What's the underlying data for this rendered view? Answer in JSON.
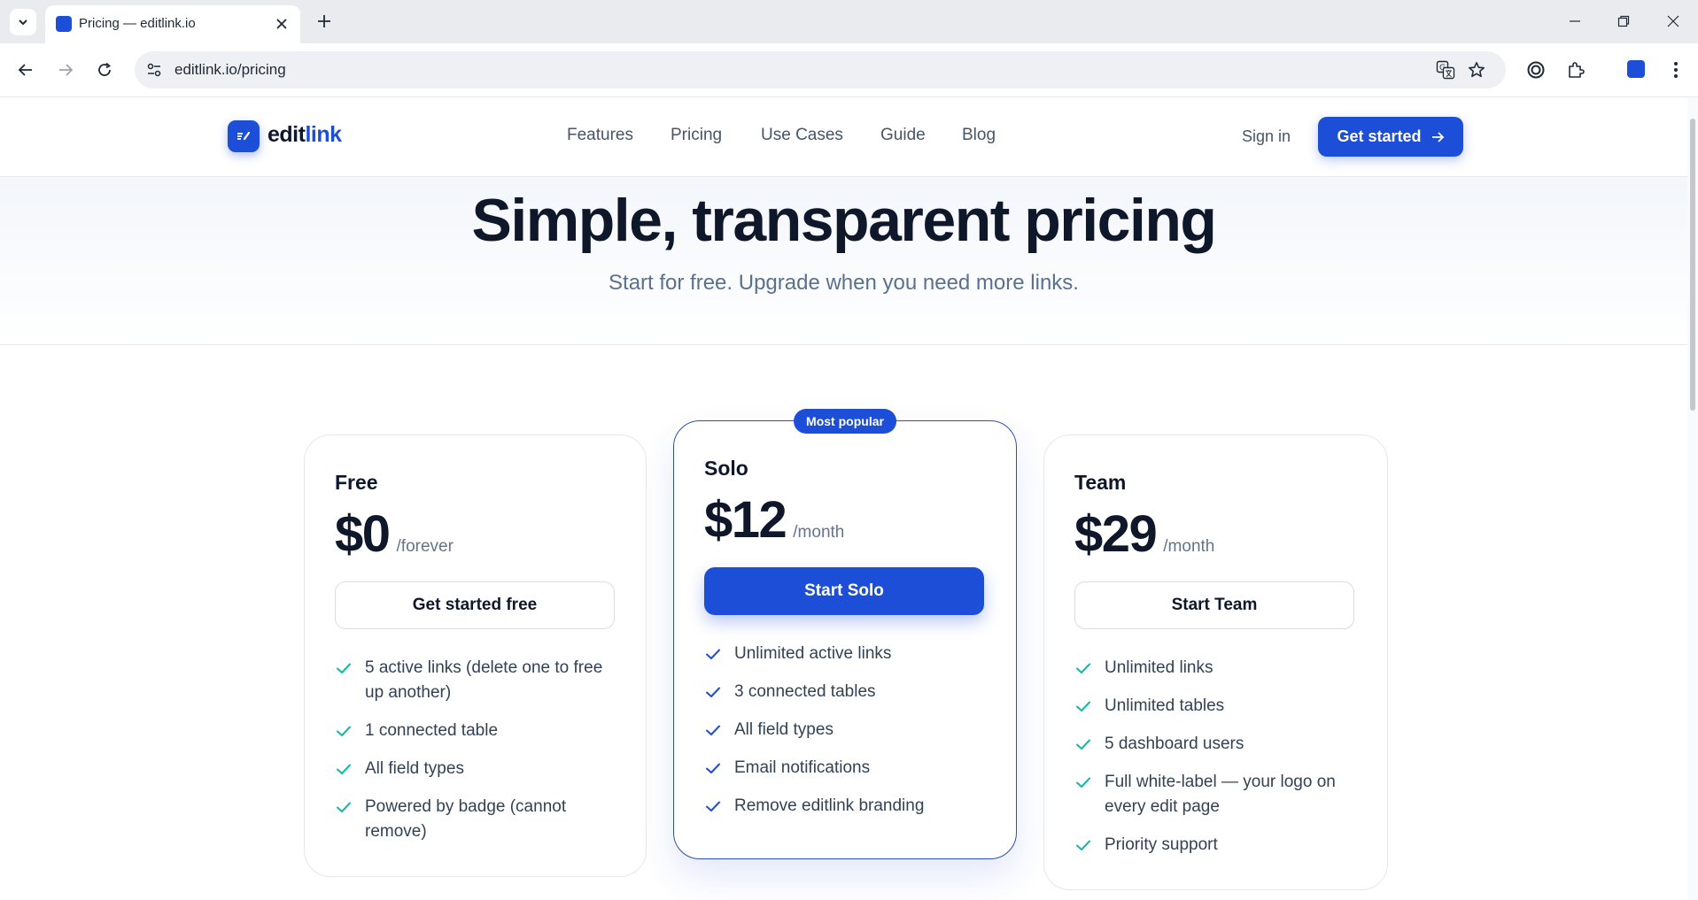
{
  "browser": {
    "tab_title": "Pricing — editlink.io",
    "url": "editlink.io/pricing",
    "icons": [
      "tab-list-icon",
      "close-icon",
      "plus-icon",
      "minimize-icon",
      "restore-icon",
      "window-close-icon",
      "back-icon",
      "forward-icon",
      "reload-icon",
      "site-info-icon",
      "translate-icon",
      "star-icon",
      "circle-extension-icon",
      "puzzle-icon",
      "menu-dots-icon"
    ]
  },
  "header": {
    "logo_text_main": "edit",
    "logo_text_accent": "link",
    "nav": [
      "Features",
      "Pricing",
      "Use Cases",
      "Guide",
      "Blog"
    ],
    "sign_in": "Sign in",
    "get_started": "Get started"
  },
  "hero": {
    "title": "Simple, transparent pricing",
    "subtitle": "Start for free. Upgrade when you need more links."
  },
  "plans": [
    {
      "name": "Free",
      "price": "$0",
      "period": "/forever",
      "cta": "Get started free",
      "features": [
        "5 active links (delete one to free up another)",
        "1 connected table",
        "All field types",
        "Powered by badge (cannot remove)"
      ]
    },
    {
      "badge": "Most popular",
      "name": "Solo",
      "price": "$12",
      "period": "/month",
      "cta": "Start Solo",
      "features": [
        "Unlimited active links",
        "3 connected tables",
        "All field types",
        "Email notifications",
        "Remove editlink branding"
      ]
    },
    {
      "name": "Team",
      "price": "$29",
      "period": "/month",
      "cta": "Start Team",
      "features": [
        "Unlimited links",
        "Unlimited tables",
        "5 dashboard users",
        "Full white-label — your logo on every edit page",
        "Priority support"
      ]
    }
  ],
  "colors": {
    "brand": "#1d4ed8",
    "check": "#14b8a6",
    "heading": "#0f172a",
    "muted": "#64748b"
  }
}
